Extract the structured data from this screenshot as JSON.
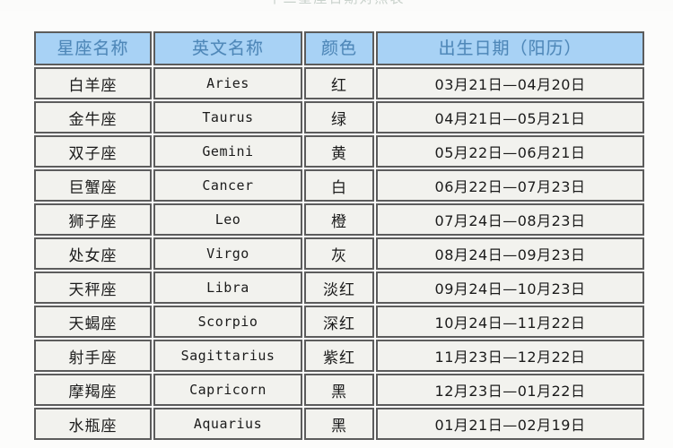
{
  "page": {
    "faint_top_title": "十二星座日期对照表",
    "background_color": "#fcfcfb"
  },
  "table": {
    "header_bg": "#a8d2f5",
    "header_text_color": "#4e87b8",
    "cell_bg": "#f2f2ee",
    "border_color": "#5c5c5c",
    "columns": [
      {
        "key": "name",
        "label": "星座名称"
      },
      {
        "key": "eng",
        "label": "英文名称"
      },
      {
        "key": "color",
        "label": "颜色"
      },
      {
        "key": "date",
        "label": "出生日期（阳历）"
      }
    ],
    "rows": [
      {
        "name": "白羊座",
        "eng": "Aries",
        "color": "红",
        "date": "03月21日—04月20日"
      },
      {
        "name": "金牛座",
        "eng": "Taurus",
        "color": "绿",
        "date": "04月21日—05月21日"
      },
      {
        "name": "双子座",
        "eng": "Gemini",
        "color": "黄",
        "date": "05月22日—06月21日"
      },
      {
        "name": "巨蟹座",
        "eng": "Cancer",
        "color": "白",
        "date": "06月22日—07月23日"
      },
      {
        "name": "狮子座",
        "eng": "Leo",
        "color": "橙",
        "date": "07月24日—08月23日"
      },
      {
        "name": "处女座",
        "eng": "Virgo",
        "color": "灰",
        "date": "08月24日—09月23日"
      },
      {
        "name": "天秤座",
        "eng": "Libra",
        "color": "淡红",
        "date": "09月24日—10月23日"
      },
      {
        "name": "天蝎座",
        "eng": "Scorpio",
        "color": "深红",
        "date": "10月24日—11月22日"
      },
      {
        "name": "射手座",
        "eng": "Sagittarius",
        "color": "紫红",
        "date": "11月23日—12月22日"
      },
      {
        "name": "摩羯座",
        "eng": "Capricorn",
        "color": "黑",
        "date": "12月23日—01月22日"
      },
      {
        "name": "水瓶座",
        "eng": "Aquarius",
        "color": "黑",
        "date": "01月21日—02月19日"
      }
    ]
  }
}
